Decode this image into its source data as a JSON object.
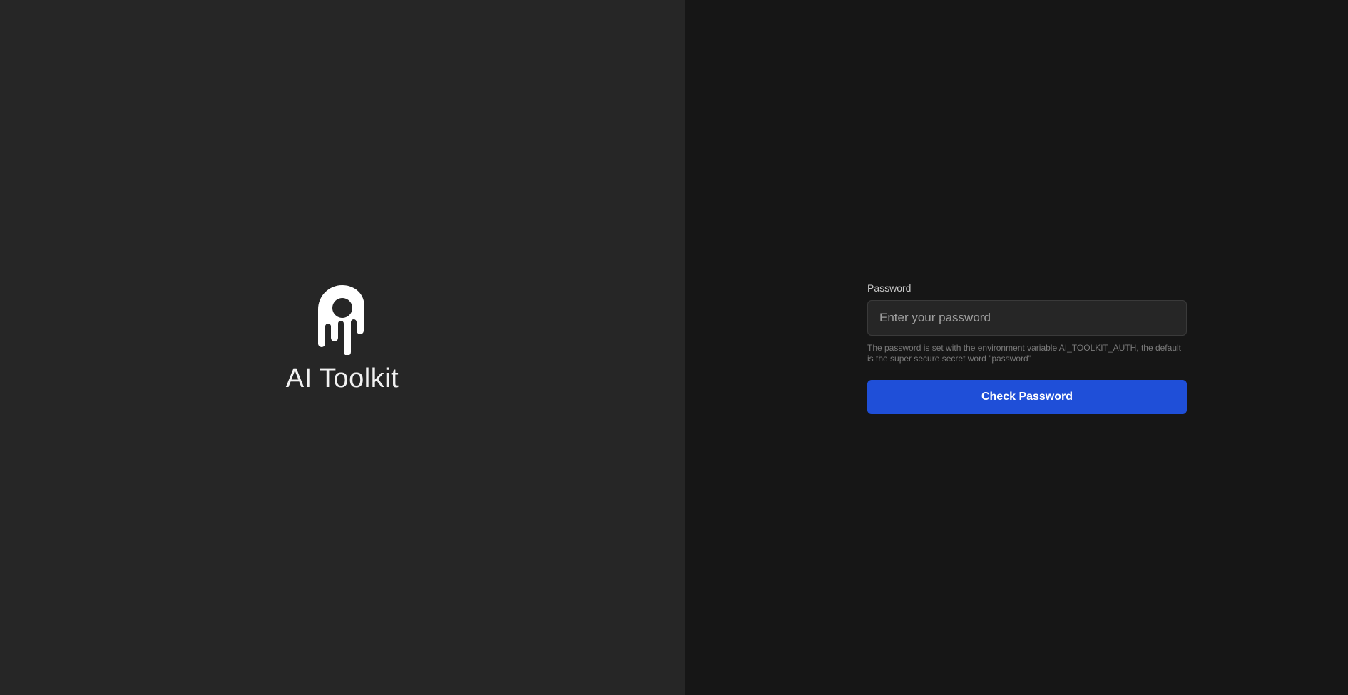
{
  "brand": {
    "name": "AI Toolkit",
    "logo_icon": "droplet-ghost-logo-icon"
  },
  "login": {
    "label": "Password",
    "input_value": "",
    "input_placeholder": "Enter your password",
    "hint": "The password is set with the environment variable AI_TOOLKIT_AUTH, the default is the super secure secret word \"password\"",
    "submit_label": "Check Password"
  },
  "colors": {
    "left_panel_bg": "#262626",
    "right_panel_bg": "#161616",
    "button_bg": "#1f4fd8",
    "input_bg": "#262626"
  }
}
